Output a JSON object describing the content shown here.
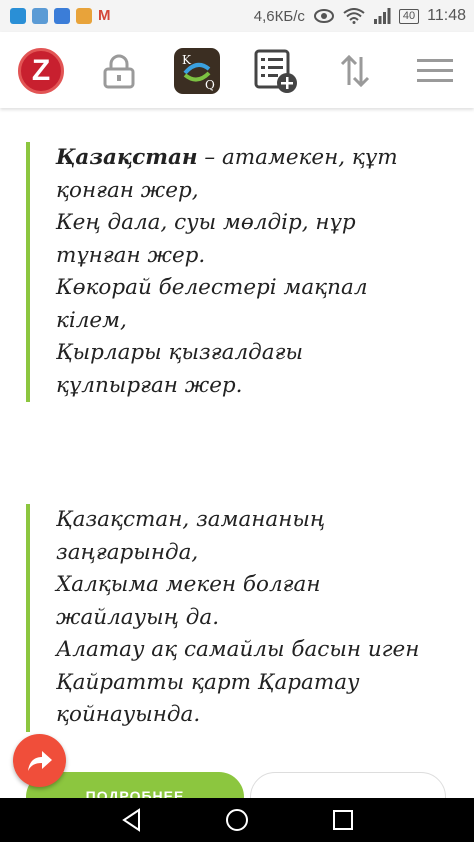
{
  "status_bar": {
    "speed": "4,6КБ/с",
    "battery": "40",
    "time": "11:48"
  },
  "toolbar": {
    "logo_letter": "Z"
  },
  "poem1": {
    "title": "Қазақстан",
    "lines": [
      " – атамекен, құт",
      "қонған жер,",
      "Кең дала, суы мөлдір, нұр",
      "тұнған жер.",
      "Көкорай белестері мақпал",
      "кілем,",
      "Қырлары қызғалдағы",
      "құлпырған жер."
    ]
  },
  "poem2": {
    "lines": [
      "Қазақстан, замананың",
      "заңғарында,",
      "Халқыма мекен болған",
      "жайлауың да.",
      "Алатау ақ самайлы басын иген",
      "Қайратты қарт Қаратау",
      "қойнауында."
    ]
  },
  "buttons": {
    "more_label": "ПОДРОБНЕЕ"
  },
  "colors": {
    "accent_green": "#8cc63f",
    "share_red": "#f04e3a",
    "logo_red": "#c8202f"
  }
}
